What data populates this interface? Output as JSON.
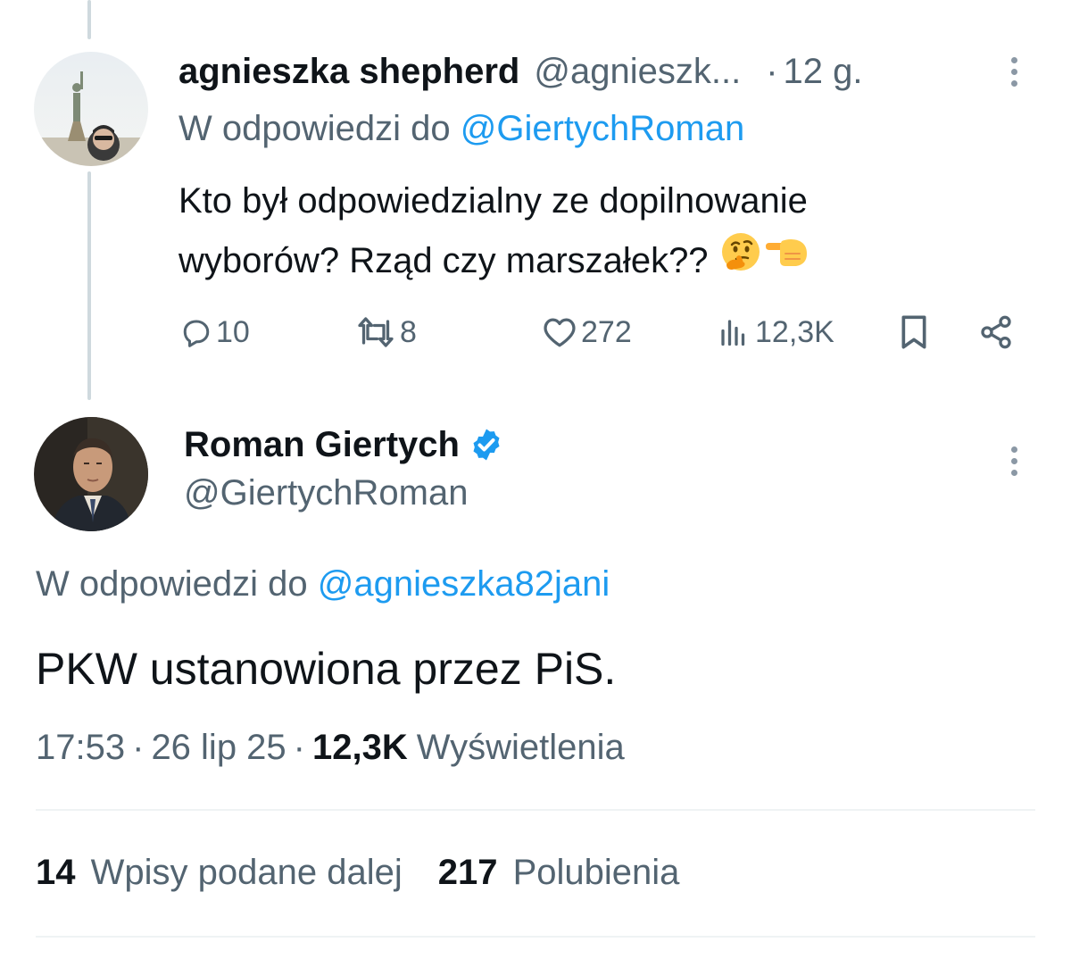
{
  "reply_tweet": {
    "author_name": "agnieszka shepherd",
    "author_handle": "@agnieszk...",
    "separator": "·",
    "time": "12 g.",
    "reply_prefix": "W odpowiedzi do",
    "reply_to": "@GiertychRoman",
    "text_line1": "Kto był odpowiedzialny ze dopilnowanie",
    "text_line2": "wyborów? Rząd czy marszałek??",
    "emojis": [
      "thinking-face",
      "backhand-index-pointing-left"
    ],
    "actions": {
      "replies": "10",
      "reposts": "8",
      "likes": "272",
      "views": "12,3K"
    }
  },
  "main_tweet": {
    "author_name": "Roman Giertych",
    "verified": true,
    "author_handle": "@GiertychRoman",
    "reply_prefix": "W odpowiedzi do",
    "reply_to": "@agnieszka82jani",
    "text": "PKW ustanowiona przez PiS.",
    "time": "17:53",
    "date": "26 lip 25",
    "views_count": "12,3K",
    "views_label": "Wyświetlenia",
    "reposts_count": "14",
    "reposts_label": "Wpisy podane dalej",
    "likes_count": "217",
    "likes_label": "Polubienia"
  },
  "colors": {
    "text": "#0f1419",
    "muted": "#536471",
    "link": "#1d9bf0",
    "verified": "#1d9bf0",
    "divider": "#eff3f4",
    "thread_line": "#cfd9de"
  }
}
